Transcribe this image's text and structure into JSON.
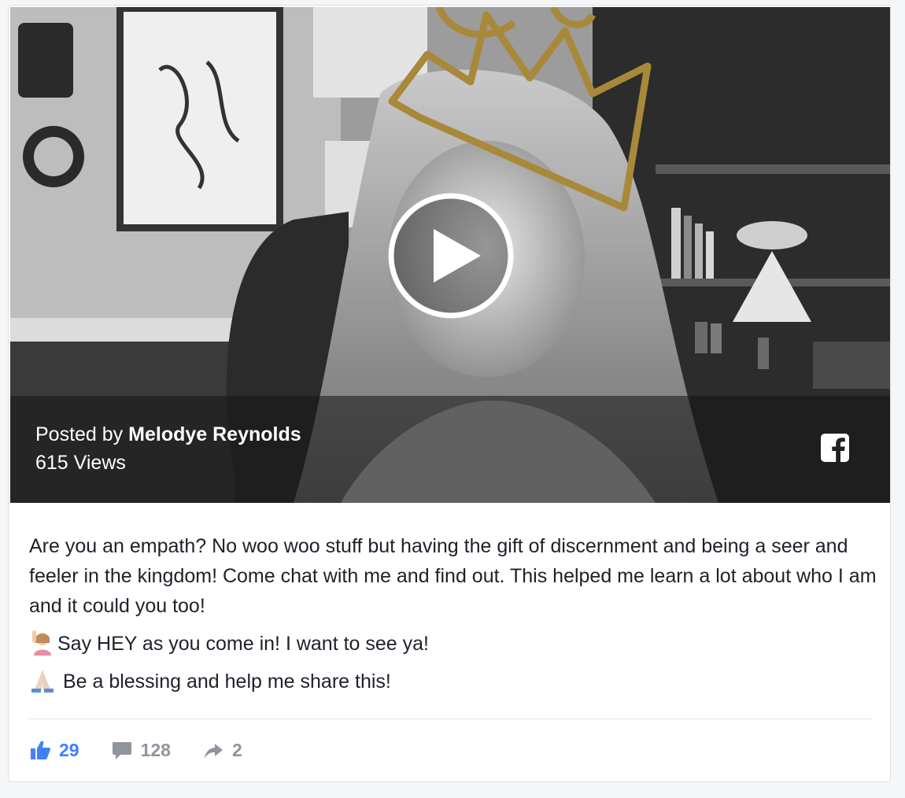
{
  "post": {
    "posted_prefix": "Posted by",
    "author": "Melodye Reynolds",
    "views": "615 Views",
    "paragraphs": [
      "Are you an empath? No woo woo stuff but having the gift of discernment and being a seer and feeler in the kingdom! Come chat with me and find out. This helped me learn a lot about who I am and it could you too!",
      "Say HEY as you come in! I want to see ya!",
      " Be a blessing and help me share this!"
    ],
    "emojis": [
      "raising-hand-emoji",
      "folded-hands-emoji"
    ]
  },
  "actions": {
    "likes": "29",
    "comments": "128",
    "shares": "2"
  },
  "colors": {
    "like_blue": "#4080ff",
    "action_grey": "#90949c",
    "crown_gold": "#a8893a",
    "text": "#1d2129"
  },
  "icons": [
    "play-icon",
    "facebook-icon",
    "like-icon",
    "comment-icon",
    "share-icon"
  ]
}
